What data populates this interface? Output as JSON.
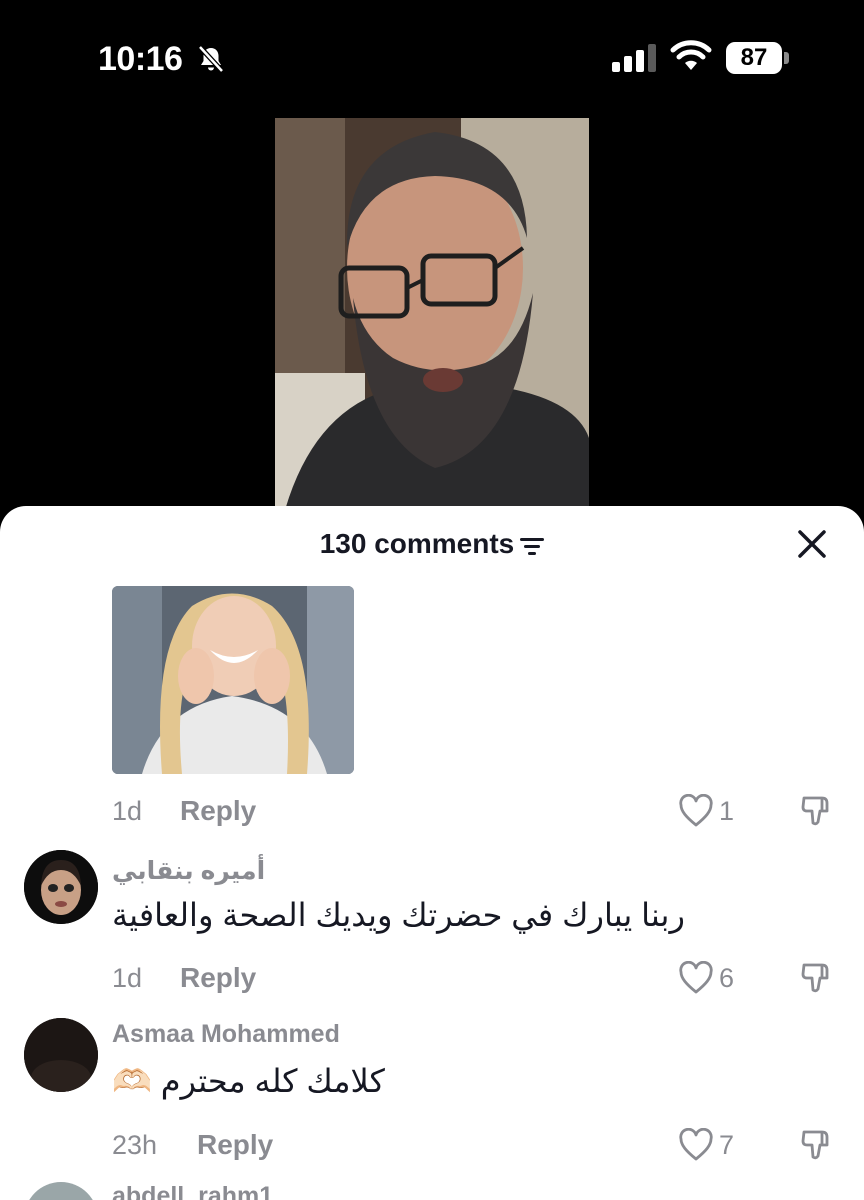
{
  "status_bar": {
    "time": "10:16",
    "battery": "87"
  },
  "sheet": {
    "title": "130 comments"
  },
  "comments": [
    {
      "ago": "1d",
      "reply_label": "Reply",
      "likes": "1"
    },
    {
      "username": "أميره بنقابي",
      "text": "ربنا يبارك في حضرتك ويديك الصحة والعافية",
      "ago": "1d",
      "reply_label": "Reply",
      "likes": "6"
    },
    {
      "username": "Asmaa Mohammed",
      "text": "كلامك كله محترم",
      "emoji": "🫶🏻",
      "ago": "23h",
      "reply_label": "Reply",
      "likes": "7"
    },
    {
      "username": "abdell_rahm1"
    }
  ],
  "colors": {
    "text_primary": "#161823",
    "text_secondary": "#8a8b91",
    "background": "#ffffff"
  }
}
